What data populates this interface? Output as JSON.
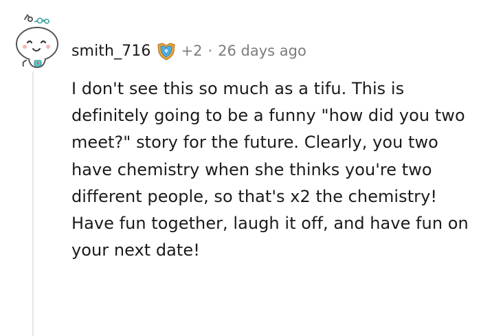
{
  "comment": {
    "author": "smith_716",
    "award_icon": "shield-award-icon",
    "award_count": "+2",
    "separator": "·",
    "timestamp": "26 days ago",
    "body": "I don't see this so much as a tifu. This is definitely going to be a funny \"how did you two meet?\" story for the future. Clearly, you two have chemistry when she thinks you're two different people, so that's x2 the chemistry! Have fun together, laugh it off, and have fun on your next date!"
  },
  "colors": {
    "text": "#1a1a1b",
    "meta": "#7c7c7c",
    "award_blue": "#4fb3e8",
    "award_gold": "#e8a63a",
    "thread_line": "#e6e6e6"
  }
}
